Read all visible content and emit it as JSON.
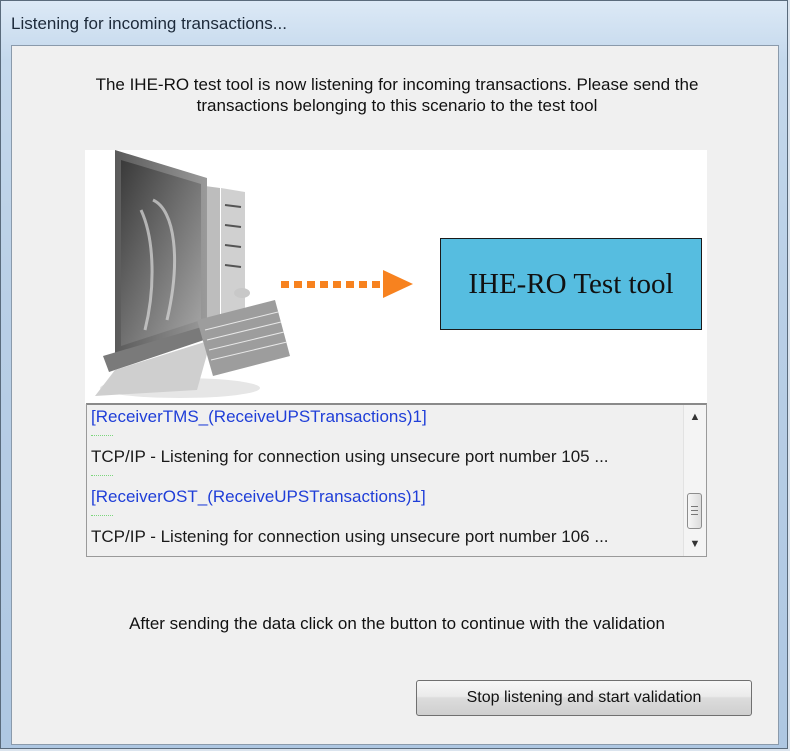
{
  "window": {
    "title": "Listening for incoming transactions..."
  },
  "intro_text": "The IHE-RO test tool is now listening for incoming transactions. Please send the transactions belonging to this scenario to the test tool",
  "graphic": {
    "tool_label": "IHE-RO Test tool",
    "icons": [
      "workstation-icon",
      "arrow-right-icon"
    ],
    "accent_orange": "#f7821f",
    "box_blue": "#56bde0"
  },
  "log": {
    "lines": [
      {
        "text": "[ReceiverTMS_(ReceiveUPSTransactions)1]",
        "style": "blue"
      },
      {
        "text": "TCP/IP - Listening for connection using unsecure port number 105 ...",
        "style": "dark"
      },
      {
        "text": "[ReceiverOST_(ReceiveUPSTransactions)1]",
        "style": "blue"
      },
      {
        "text": "TCP/IP - Listening for connection using unsecure port number 106 ...",
        "style": "dark"
      }
    ]
  },
  "footer_text": "After sending the data click on the button to continue with the validation",
  "buttons": {
    "stop_validation": "Stop listening and start validation"
  }
}
